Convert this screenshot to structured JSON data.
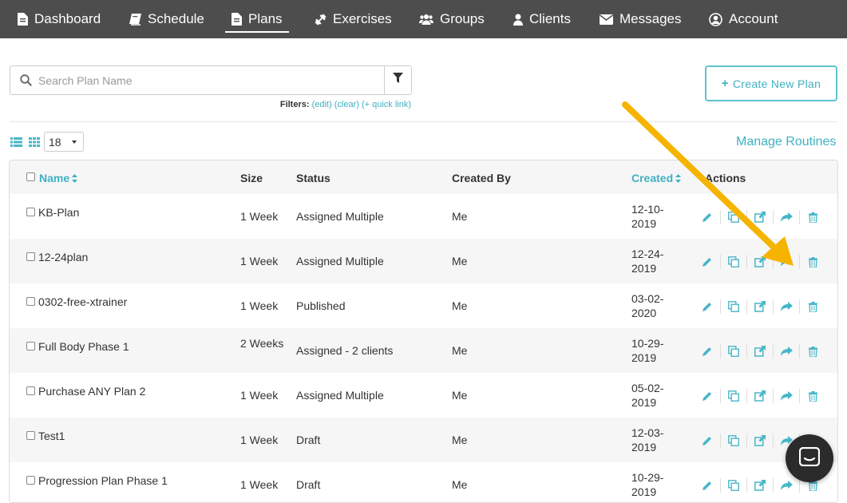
{
  "nav": {
    "items": [
      {
        "label": "Dashboard",
        "icon": "document-icon"
      },
      {
        "label": "Schedule",
        "icon": "book-icon"
      },
      {
        "label": "Plans",
        "icon": "document-icon",
        "active": true
      },
      {
        "label": "Exercises",
        "icon": "dumbbell-icon"
      },
      {
        "label": "Groups",
        "icon": "users-icon"
      },
      {
        "label": "Clients",
        "icon": "user-icon"
      },
      {
        "label": "Messages",
        "icon": "envelope-icon"
      },
      {
        "label": "Account",
        "icon": "user-circle-icon"
      }
    ]
  },
  "search": {
    "placeholder": "Search Plan Name"
  },
  "filters": {
    "label": "Filters:",
    "edit": "(edit)",
    "clear": "(clear)",
    "quick_link": "(+ quick link)"
  },
  "create_button": "Create New Plan",
  "per_page": "18",
  "manage_routines": "Manage Routines",
  "table": {
    "headers": {
      "name": "Name",
      "size": "Size",
      "status": "Status",
      "created_by": "Created By",
      "created": "Created",
      "actions": "Actions"
    },
    "rows": [
      {
        "name": "KB-Plan",
        "size": "1 Week",
        "status": "Assigned Multiple",
        "created_by": "Me",
        "date_line1": "12-10-",
        "date_line2": "2019"
      },
      {
        "name": "12-24plan",
        "size": "1 Week",
        "status": "Assigned Multiple",
        "created_by": "Me",
        "date_line1": "12-24-",
        "date_line2": "2019"
      },
      {
        "name": "0302-free-xtrainer",
        "size": "1 Week",
        "status": "Published",
        "created_by": "Me",
        "date_line1": "03-02-",
        "date_line2": "2020"
      },
      {
        "name": "Full Body Phase 1",
        "size": "2 Weeks",
        "status": "Assigned - 2 clients",
        "created_by": "Me",
        "date_line1": "10-29-",
        "date_line2": "2019"
      },
      {
        "name": "Purchase ANY Plan 2",
        "size": "1 Week",
        "status": "Assigned Multiple",
        "created_by": "Me",
        "date_line1": "05-02-",
        "date_line2": "2019"
      },
      {
        "name": "Test1",
        "size": "1 Week",
        "status": "Draft",
        "created_by": "Me",
        "date_line1": "12-03-",
        "date_line2": "2019"
      },
      {
        "name": "Progression Plan Phase 1",
        "size": "1 Week",
        "status": "Draft",
        "created_by": "Me",
        "date_line1": "10-29-",
        "date_line2": "2019"
      }
    ]
  },
  "colors": {
    "accent": "#3fb1c3",
    "nav_bg": "#4d4d4d",
    "arrow": "#f5b400"
  }
}
